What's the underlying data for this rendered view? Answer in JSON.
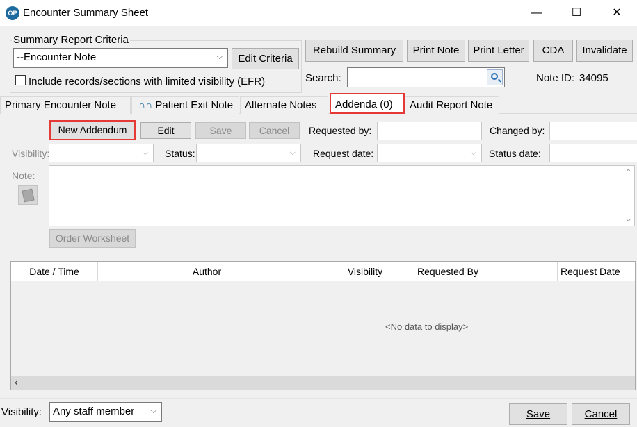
{
  "window": {
    "title": "Encounter Summary Sheet",
    "app_icon_text": "OP",
    "controls": {
      "minimize": "—",
      "maximize": "☐",
      "close": "✕"
    }
  },
  "criteria": {
    "group_label": "Summary Report Criteria",
    "selected": "--Encounter Note",
    "edit_button": "Edit Criteria",
    "efr_label": "Include records/sections with limited visibility (EFR)",
    "efr_checked": false
  },
  "toolbar": {
    "rebuild": "Rebuild Summary",
    "print_note": "Print Note",
    "print_letter": "Print Letter",
    "cda": "CDA",
    "invalidate": "Invalidate"
  },
  "search": {
    "label": "Search:",
    "value": ""
  },
  "note_id": {
    "label": "Note ID:",
    "value": "34095"
  },
  "tabs": [
    {
      "label": "Primary Encounter Note",
      "active": false
    },
    {
      "label": "Patient Exit Note",
      "active": false,
      "icon": "patient-exit-icon"
    },
    {
      "label": "Alternate Notes",
      "active": false
    },
    {
      "label": "Addenda (0)",
      "active": true
    },
    {
      "label": "Audit Report Note",
      "active": false
    }
  ],
  "addenda": {
    "new_button": "New Addendum",
    "edit_button": "Edit",
    "save_button": "Save",
    "cancel_button": "Cancel",
    "requested_by_label": "Requested by:",
    "changed_by_label": "Changed by:",
    "visibility_label": "Visibility:",
    "status_label": "Status:",
    "request_date_label": "Request date:",
    "status_date_label": "Status date:",
    "note_label": "Note:",
    "order_worksheet_button": "Order Worksheet"
  },
  "table": {
    "columns": [
      "Date / Time",
      "Author",
      "Visibility",
      "Requested By",
      "Request Date"
    ],
    "rows": [],
    "empty_text": "<No data to display>"
  },
  "footer": {
    "visibility_label": "Visibility:",
    "visibility_value": "Any staff member",
    "save_button": "Save",
    "cancel_button": "Cancel"
  },
  "colors": {
    "highlight": "#e53935",
    "app_icon": "#1d6a9e"
  }
}
